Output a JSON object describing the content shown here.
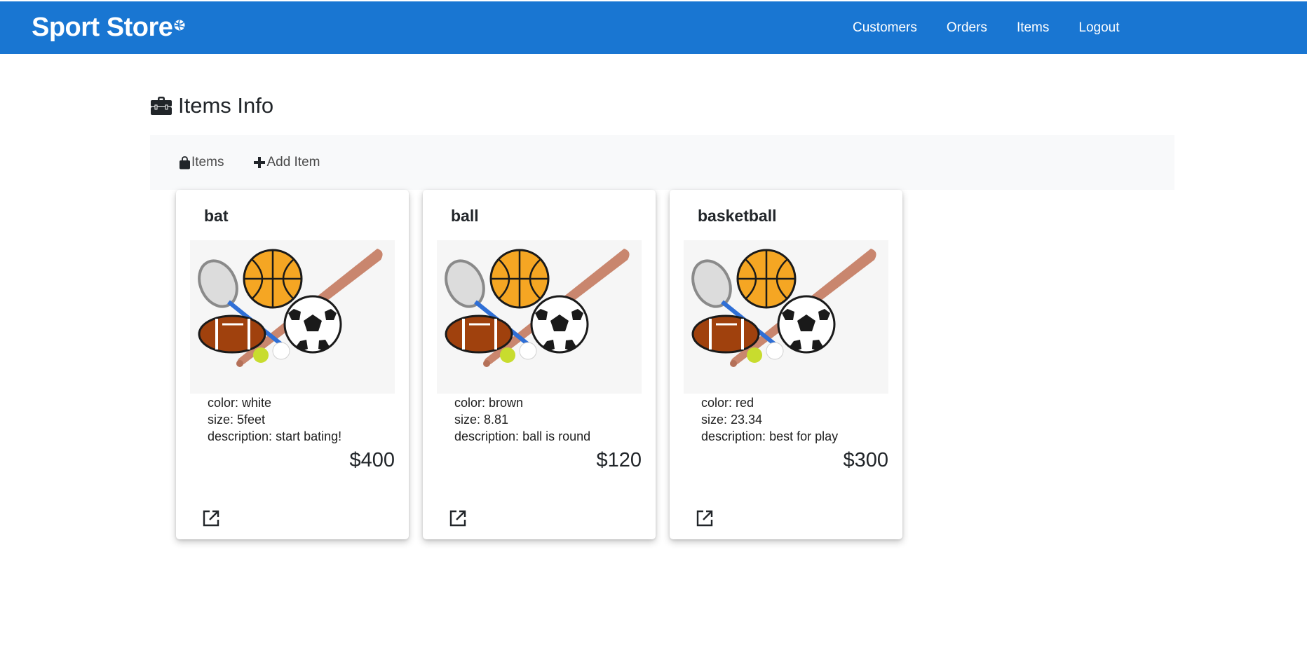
{
  "navbar": {
    "brand": "Sport Store",
    "brand_icon": "sports-ball-icon",
    "links": [
      "Customers",
      "Orders",
      "Items",
      "Logout"
    ],
    "color": "#1976d2"
  },
  "page": {
    "title": "Items Info",
    "title_icon": "toolbox-icon"
  },
  "subnav": {
    "items": {
      "label": "Items",
      "icon": "shopping-bag-icon"
    },
    "add": {
      "label": "Add Item",
      "icon": "plus-icon"
    }
  },
  "cards": [
    {
      "name": "bat",
      "color_label": "color:",
      "color": "white",
      "size_label": "size:",
      "size": "5feet",
      "desc_label": "description:",
      "description": "start bating!",
      "price": "$400",
      "action_icon": "open-in-new-icon"
    },
    {
      "name": "ball",
      "color_label": "color:",
      "color": "brown",
      "size_label": "size:",
      "size": "8.81",
      "desc_label": "description:",
      "description": "ball is round",
      "price": "$120",
      "action_icon": "open-in-new-icon"
    },
    {
      "name": "basketball",
      "color_label": "color:",
      "color": "red",
      "size_label": "size:",
      "size": "23.34",
      "desc_label": "description:",
      "description": "best for play",
      "price": "$300",
      "action_icon": "open-in-new-icon"
    }
  ]
}
